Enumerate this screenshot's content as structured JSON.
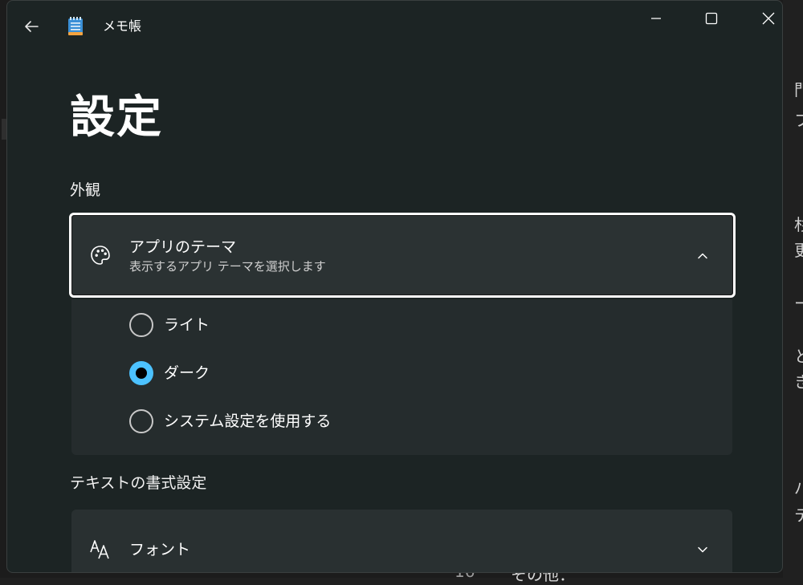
{
  "window": {
    "app_title": "メモ帳"
  },
  "page": {
    "title": "設定"
  },
  "sections": {
    "appearance": "外観",
    "text_format": "テキストの書式設定"
  },
  "theme": {
    "title": "アプリのテーマ",
    "subtitle": "表示するアプリ テーマを選択します",
    "options": [
      {
        "label": "ライト",
        "checked": false
      },
      {
        "label": "ダーク",
        "checked": true
      },
      {
        "label": "システム設定を使用する",
        "checked": false
      }
    ]
  },
  "font": {
    "title": "フォント"
  },
  "background_fragments": {
    "right": [
      "門",
      "フ",
      "杉",
      "更",
      "ー",
      "と",
      "き",
      "パ",
      "テ"
    ],
    "bottom_number": "16",
    "bottom_text": "その他："
  },
  "icons": {
    "back": "arrow-left-icon",
    "app": "notepad-icon",
    "minimize": "minimize-icon",
    "maximize": "maximize-icon",
    "close": "close-icon",
    "theme": "palette-icon",
    "font": "font-icon",
    "collapse": "chevron-up-icon",
    "expand": "chevron-down-icon"
  },
  "colors": {
    "accent": "#4cc2ff",
    "window_bg": "#1c2424",
    "card_bg": "#293031"
  }
}
